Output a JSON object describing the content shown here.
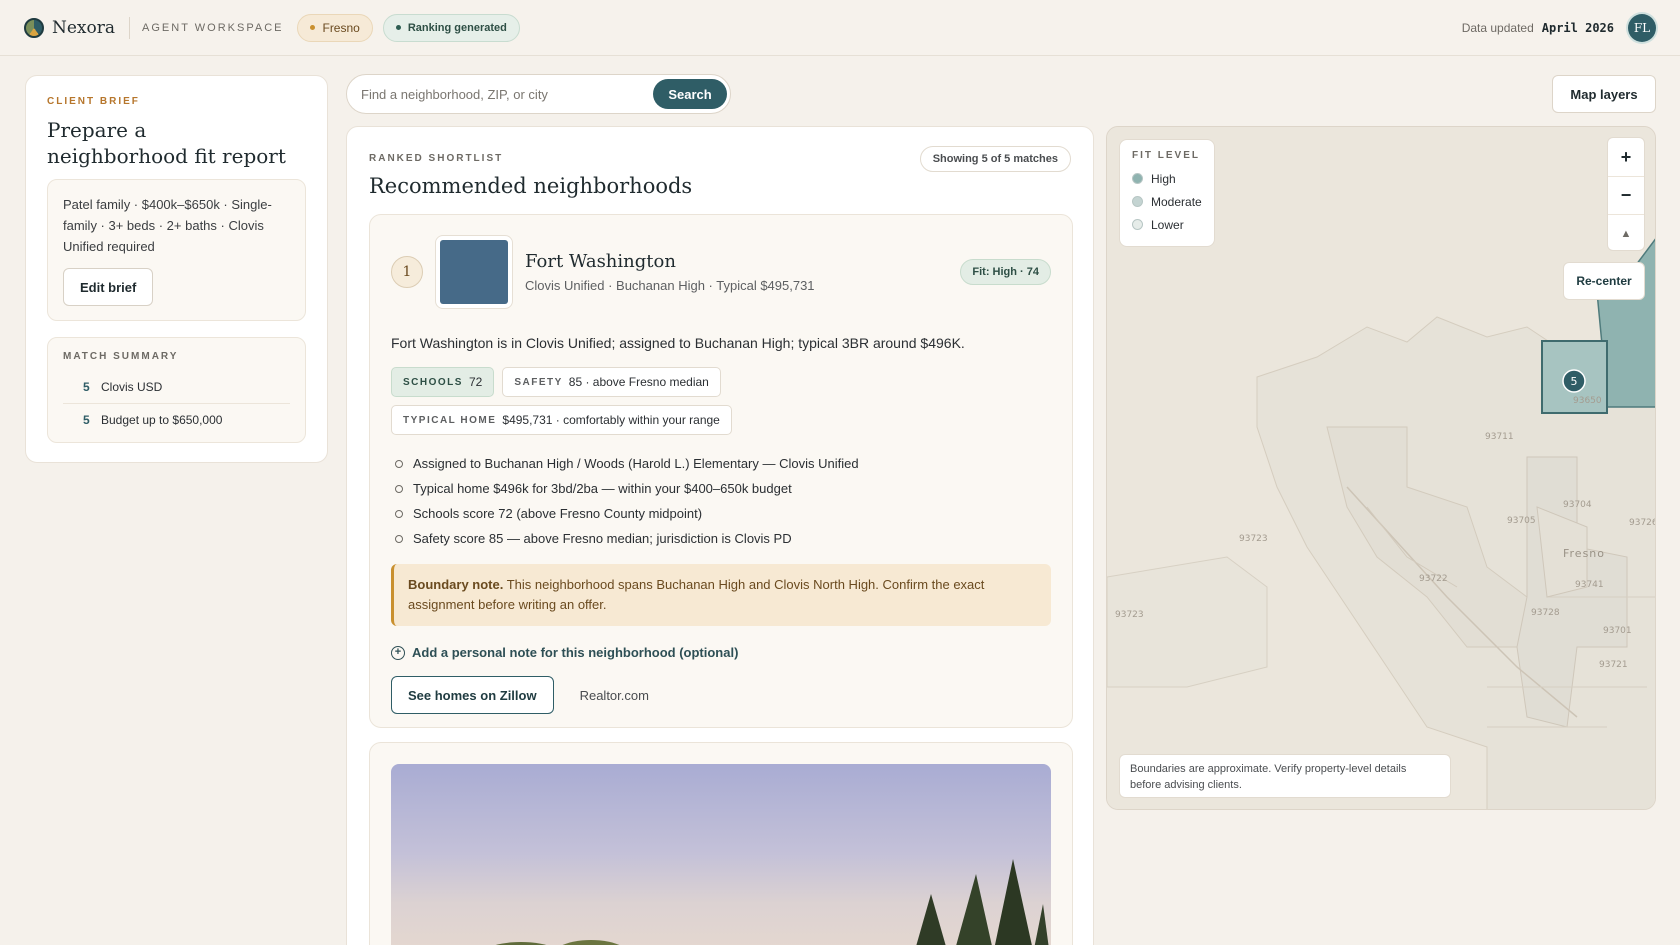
{
  "header": {
    "brand": "Nexora",
    "workspace": "AGENT WORKSPACE",
    "location_pill": "Fresno",
    "status_pill": "Ranking generated",
    "updated_label": "Data updated",
    "updated_value": "April 2026",
    "avatar_initials": "FL"
  },
  "brief": {
    "eyebrow": "CLIENT BRIEF",
    "title": "Prepare a neighborhood fit report",
    "summary": "Patel family · $400k–$650k · Single-family · 3+ beds · 2+ baths · Clovis Unified required",
    "edit_label": "Edit brief"
  },
  "match_summary": {
    "eyebrow": "MATCH SUMMARY",
    "rows": [
      {
        "count": "5",
        "label": "Clovis USD"
      },
      {
        "count": "5",
        "label": "Budget up to $650,000"
      }
    ]
  },
  "search": {
    "placeholder": "Find a neighborhood, ZIP, or city",
    "button": "Search"
  },
  "shortlist": {
    "eyebrow": "RANKED SHORTLIST",
    "title": "Recommended neighborhoods",
    "showing": "Showing 5 of 5 matches",
    "first": {
      "rank": "1",
      "name": "Fort Washington",
      "subtitle": "Clovis Unified · Buchanan High · Typical $495,731",
      "fit": "Fit: High · 74",
      "description": "Fort Washington is in Clovis Unified; assigned to Buchanan High; typical 3BR around $496K.",
      "chips": [
        {
          "key": "SCHOOLS",
          "value": "72"
        },
        {
          "key": "SAFETY",
          "value": "85 · above Fresno median"
        },
        {
          "key": "TYPICAL HOME",
          "value": "$495,731 · comfortably within your range"
        }
      ],
      "bullets": [
        "Assigned to Buchanan High / Woods (Harold L.) Elementary — Clovis Unified",
        "Typical home $496k for 3bd/2ba — within your $400–650k budget",
        "Schools score 72 (above Fresno County midpoint)",
        "Safety score 85 — above Fresno median; jurisdiction is Clovis PD"
      ],
      "boundary_label": "Boundary note.",
      "boundary_text": "This neighborhood spans Buchanan High and Clovis North High. Confirm the exact assignment before writing an offer.",
      "add_note": "Add a personal note for this neighborhood (optional)",
      "zillow": "See homes on Zillow",
      "realtor": "Realtor.com"
    }
  },
  "map": {
    "layers_button": "Map layers",
    "legend_title": "FIT LEVEL",
    "legend": [
      {
        "label": "High",
        "color": "#8fb3b0"
      },
      {
        "label": "Moderate",
        "color": "#c4d4d2"
      },
      {
        "label": "Lower",
        "color": "#e6ece9"
      }
    ],
    "zoom_in": "+",
    "zoom_out": "−",
    "compass": "▲",
    "recenter": "Re-center",
    "marker": "5",
    "city_label": "Fresno",
    "zip_labels": [
      "93711",
      "93650",
      "93704",
      "93705",
      "93726",
      "93723",
      "93722",
      "93741",
      "93728",
      "93701",
      "93723",
      "93721"
    ],
    "note": "Boundaries are approximate. Verify property-level details before advising clients."
  }
}
